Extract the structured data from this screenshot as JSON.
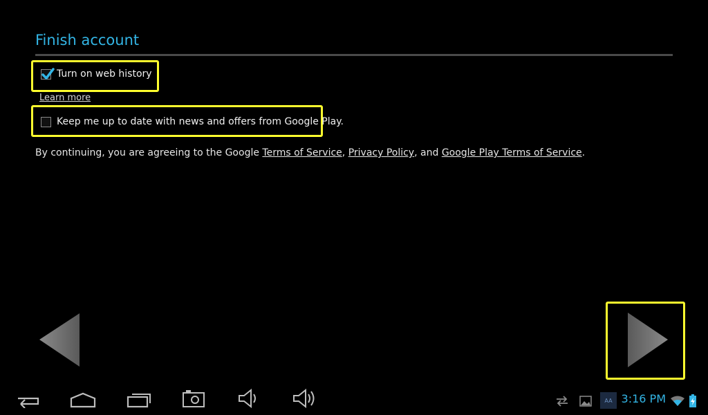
{
  "page": {
    "title": "Finish account",
    "web_history_label": "Turn on web history",
    "web_history_checked": true,
    "learn_more": "Learn more",
    "news_label": "Keep me up to date with news and offers from Google Play.",
    "news_checked": false,
    "terms_prefix": "By continuing, you are agreeing to the Google ",
    "terms_of_service": "Terms of Service",
    "comma": ", ",
    "privacy_policy": "Privacy Policy",
    "and": ", and ",
    "play_terms": "Google Play Terms of Service",
    "period": "."
  },
  "status_bar": {
    "time": "3:16 PM",
    "accent": "#33b5e5"
  },
  "colors": {
    "highlight": "#ffff2e",
    "title": "#33b5e5"
  }
}
